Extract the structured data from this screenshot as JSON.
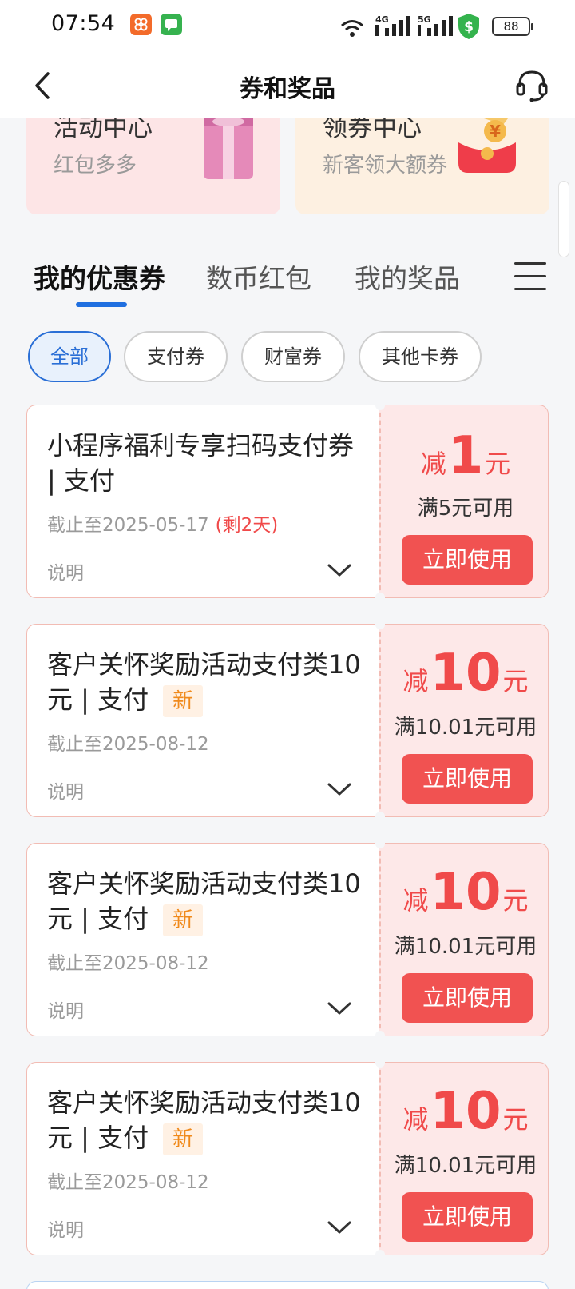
{
  "status_bar": {
    "time": "07:54",
    "battery": "88"
  },
  "nav": {
    "title": "券和奖品"
  },
  "banners": [
    {
      "title": "活动中心",
      "subtitle": "红包多多"
    },
    {
      "title": "领券中心",
      "subtitle": "新客领大额券"
    }
  ],
  "tabs": [
    {
      "label": "我的优惠券"
    },
    {
      "label": "数币红包"
    },
    {
      "label": "我的奖品"
    }
  ],
  "filters": [
    {
      "label": "全部"
    },
    {
      "label": "支付券"
    },
    {
      "label": "财富券"
    },
    {
      "label": "其他卡券"
    }
  ],
  "coupons": [
    {
      "title": "小程序福利专享扫码支付券 | 支付",
      "new_tag": "",
      "expiry": "截止至2025-05-17",
      "remaining": "(剩2天)",
      "note": "说明",
      "prefix": "减",
      "amount": "1",
      "unit": "元",
      "min_spend": "满5元可用",
      "button": "立即使用"
    },
    {
      "title": "客户关怀奖励活动支付类10元 | 支付",
      "new_tag": "新",
      "expiry": "截止至2025-08-12",
      "remaining": "",
      "note": "说明",
      "prefix": "减",
      "amount": "10",
      "unit": "元",
      "min_spend": "满10.01元可用",
      "button": "立即使用"
    },
    {
      "title": "客户关怀奖励活动支付类10元 | 支付",
      "new_tag": "新",
      "expiry": "截止至2025-08-12",
      "remaining": "",
      "note": "说明",
      "prefix": "减",
      "amount": "10",
      "unit": "元",
      "min_spend": "满10.01元可用",
      "button": "立即使用"
    },
    {
      "title": "客户关怀奖励活动支付类10元 | 支付",
      "new_tag": "新",
      "expiry": "截止至2025-08-12",
      "remaining": "",
      "note": "说明",
      "prefix": "减",
      "amount": "10",
      "unit": "元",
      "min_spend": "满10.01元可用",
      "button": "立即使用"
    }
  ],
  "colors": {
    "accent": "#1f6fe0",
    "coupon_red": "#f15251",
    "new_orange": "#f08a1c"
  }
}
